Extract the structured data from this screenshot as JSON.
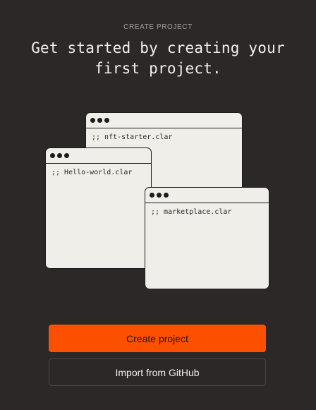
{
  "empty_state": {
    "eyebrow": "CREATE PROJECT",
    "headline_line1": "Get started by creating your",
    "headline_line2": "first project."
  },
  "illustration": {
    "windows": [
      {
        "filename": ";; nft-starter.clar"
      },
      {
        "filename": ";; Hello-world.clar"
      },
      {
        "filename": ";; marketplace.clar"
      }
    ]
  },
  "actions": {
    "create_label": "Create project",
    "import_label": "Import from GitHub"
  },
  "colors": {
    "background": "#2b2827",
    "accent": "#fc4f00",
    "window_fill": "#f0eee8"
  }
}
